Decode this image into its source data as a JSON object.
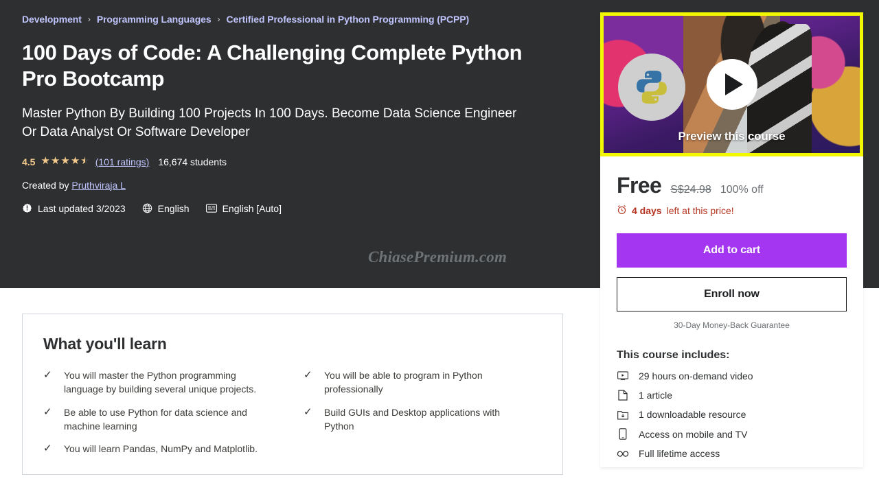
{
  "breadcrumb": {
    "separator": "›",
    "items": [
      "Development",
      "Programming Languages",
      "Certified Professional in Python Programming (PCPP)"
    ]
  },
  "course": {
    "title": "100 Days of Code: A Challenging Complete Python Pro Bootcamp",
    "headline": "Master Python By Building 100 Projects In 100 Days. Become Data Science Engineer Or Data Analyst Or Software Developer",
    "rating_value": "4.5",
    "stars_filled": 4,
    "stars_half": true,
    "ratings_link": "(101 ratings)",
    "students": "16,674 students",
    "created_by_label": "Created by",
    "author": "Pruthviraja L",
    "last_updated": "Last updated 3/2023",
    "language": "English",
    "captions": "English [Auto]"
  },
  "watermark": "ChiasePremium.com",
  "learn": {
    "title": "What you'll learn",
    "check_glyph": "✓",
    "left_items": [
      "You will master the Python programming language by building several unique projects.",
      "Be able to use Python for data science and machine learning",
      "You will learn Pandas, NumPy and Matplotlib."
    ],
    "right_items": [
      "You will be able to program in Python professionally",
      "Build GUIs and Desktop applications with Python"
    ]
  },
  "sidebar": {
    "preview_label": "Preview this course",
    "price_now": "Free",
    "price_old": "S$24.98",
    "discount": "100% off",
    "deadline_bold": "4 days",
    "deadline_rest": "left at this price!",
    "add_to_cart": "Add to cart",
    "enroll_now": "Enroll now",
    "guarantee": "30-Day Money-Back Guarantee",
    "includes_title": "This course includes:",
    "includes": [
      {
        "icon": "video-icon",
        "label": "29 hours on-demand video"
      },
      {
        "icon": "article-icon",
        "label": "1 article"
      },
      {
        "icon": "download-icon",
        "label": "1 downloadable resource"
      },
      {
        "icon": "mobile-icon",
        "label": "Access on mobile and TV"
      },
      {
        "icon": "infinity-icon",
        "label": "Full lifetime access"
      }
    ]
  },
  "colors": {
    "hero_bg": "#2d2f31",
    "link": "#c0c4fc",
    "star": "#f3ca8c",
    "accent_purple": "#a435f0",
    "deadline_red": "#b4341f",
    "preview_border": "#f2f800"
  }
}
